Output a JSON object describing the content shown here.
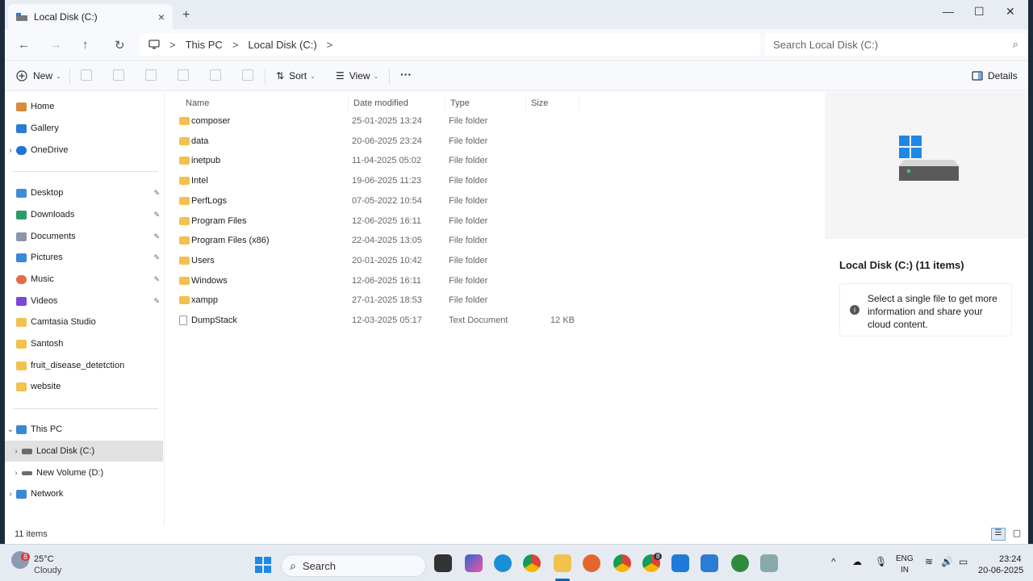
{
  "window": {
    "tab_title": "Local Disk (C:)",
    "close_tab": "×",
    "new_tab": "+",
    "min": "—",
    "max": "☐",
    "close": "✕"
  },
  "nav": {
    "back": "←",
    "forward": "→",
    "up": "↑",
    "refresh": "↻"
  },
  "breadcrumb": {
    "sep1": ">",
    "item1": "This PC",
    "sep2": ">",
    "item2": "Local Disk (C:)",
    "sep3": ">"
  },
  "search": {
    "placeholder": "Search Local Disk (C:)",
    "icon": "⌕"
  },
  "toolbar": {
    "new_label": "New",
    "sort_label": "Sort",
    "view_label": "View",
    "more": "···",
    "details_label": "Details"
  },
  "sidebar": {
    "items": [
      {
        "label": "Home",
        "icon": "home-icon",
        "color": "#d98a3a"
      },
      {
        "label": "Gallery",
        "icon": "gallery-icon",
        "color": "#2b7cd3"
      },
      {
        "label": "OneDrive",
        "icon": "cloud-icon",
        "color": "#1e73d6"
      },
      {
        "label": "Desktop",
        "icon": "desktop-icon",
        "color": "#3c8ed8"
      },
      {
        "label": "Downloads",
        "icon": "download-icon",
        "color": "#2c9c6a"
      },
      {
        "label": "Documents",
        "icon": "document-icon",
        "color": "#8a97a8"
      },
      {
        "label": "Pictures",
        "icon": "pictures-icon",
        "color": "#3a88d6"
      },
      {
        "label": "Music",
        "icon": "music-icon",
        "color": "#e46a4a"
      },
      {
        "label": "Videos",
        "icon": "video-icon",
        "color": "#7a4ad6"
      },
      {
        "label": "Camtasia Studio",
        "icon": "folder-icon",
        "color": "#f2c14e"
      },
      {
        "label": "Santosh",
        "icon": "folder-icon",
        "color": "#f2c14e"
      },
      {
        "label": "fruit_disease_detetction",
        "icon": "folder-icon",
        "color": "#f2c14e"
      },
      {
        "label": "website",
        "icon": "folder-icon",
        "color": "#f2c14e"
      },
      {
        "label": "This PC",
        "icon": "pc-icon",
        "color": "#3a88d6"
      },
      {
        "label": "Local Disk (C:)",
        "icon": "drive-icon",
        "color": "#6b6b6b"
      },
      {
        "label": "New Volume (D:)",
        "icon": "drive-icon",
        "color": "#6b6b6b"
      },
      {
        "label": "Network",
        "icon": "network-icon",
        "color": "#3a88d6"
      }
    ],
    "pin": "📌",
    "chev_right": "›",
    "chev_down": "⌄"
  },
  "columns": {
    "name": "Name",
    "date": "Date modified",
    "type": "Type",
    "size": "Size"
  },
  "files": [
    {
      "name": "composer",
      "date": "25-01-2025 13:24",
      "type": "File folder",
      "size": ""
    },
    {
      "name": "data",
      "date": "20-06-2025 23:24",
      "type": "File folder",
      "size": ""
    },
    {
      "name": "inetpub",
      "date": "11-04-2025 05:02",
      "type": "File folder",
      "size": ""
    },
    {
      "name": "Intel",
      "date": "19-06-2025 11:23",
      "type": "File folder",
      "size": ""
    },
    {
      "name": "PerfLogs",
      "date": "07-05-2022 10:54",
      "type": "File folder",
      "size": ""
    },
    {
      "name": "Program Files",
      "date": "12-06-2025 16:11",
      "type": "File folder",
      "size": ""
    },
    {
      "name": "Program Files (x86)",
      "date": "22-04-2025 13:05",
      "type": "File folder",
      "size": ""
    },
    {
      "name": "Users",
      "date": "20-01-2025 10:42",
      "type": "File folder",
      "size": ""
    },
    {
      "name": "Windows",
      "date": "12-06-2025 16:11",
      "type": "File folder",
      "size": ""
    },
    {
      "name": "xampp",
      "date": "27-01-2025 18:53",
      "type": "File folder",
      "size": ""
    },
    {
      "name": "DumpStack",
      "date": "12-03-2025 05:17",
      "type": "Text Document",
      "size": "12 KB"
    }
  ],
  "details": {
    "title": "Local Disk (C:) (11 items)",
    "info": "Select a single file to get more information and share your cloud content.",
    "info_icon": "i"
  },
  "status": {
    "count": "11 items"
  },
  "taskbar": {
    "weather_temp": "25°C",
    "weather_desc": "Cloudy",
    "weather_badge": "8",
    "search_label": "Search",
    "lang1": "ENG",
    "lang2": "IN",
    "time": "23:24",
    "date": "20-06-2025",
    "chrome_badge": "8"
  },
  "colors": {
    "folder": "#f2c14e",
    "accent": "#0067c0",
    "selected": "#e1e1e1"
  }
}
